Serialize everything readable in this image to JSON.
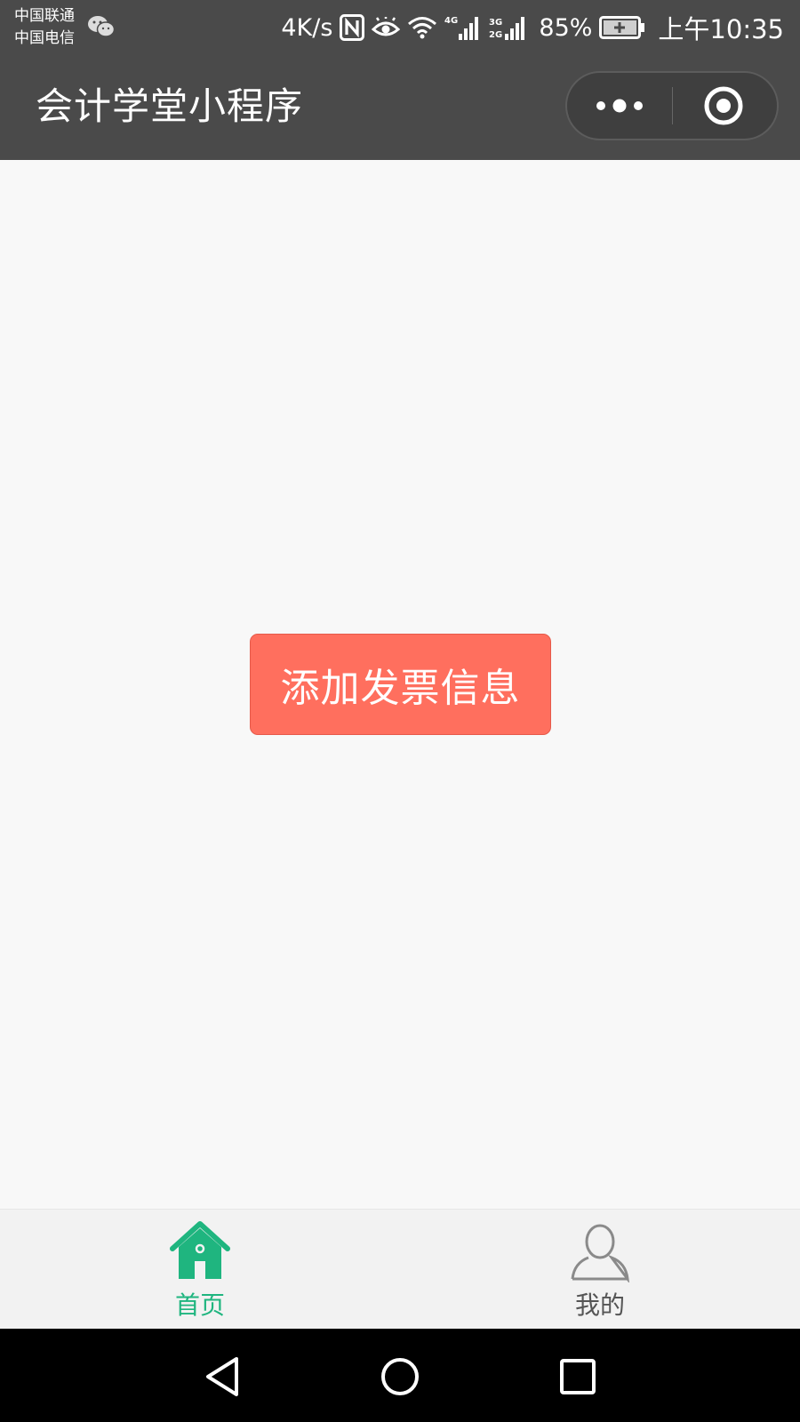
{
  "status_bar": {
    "carrier_1": "中国联通",
    "carrier_2": "中国电信",
    "net_speed": "4K/s",
    "battery_percent": "85%",
    "time": "上午10:35",
    "icons": [
      "wechat-icon",
      "nfc-icon",
      "eye-icon",
      "wifi-icon",
      "signal-4g-icon",
      "signal-3g-2g-icon",
      "battery-charging-icon"
    ]
  },
  "title_bar": {
    "title": "会计学堂小程序",
    "more_icon": "more-dots-icon",
    "close_icon": "target-circle-icon",
    "background": "#4a4a4a"
  },
  "main": {
    "add_invoice_button": "添加发票信息",
    "button_color": "#ff6f5e",
    "background": "#f8f8f8"
  },
  "tab_bar": {
    "tabs": [
      {
        "label": "首页",
        "icon": "home-icon",
        "active": true,
        "color": "#1fb57f"
      },
      {
        "label": "我的",
        "icon": "user-icon",
        "active": false,
        "color": "#555555"
      }
    ]
  },
  "nav_bar": {
    "icons": [
      "back-triangle-icon",
      "home-circle-icon",
      "recent-square-icon"
    ]
  }
}
